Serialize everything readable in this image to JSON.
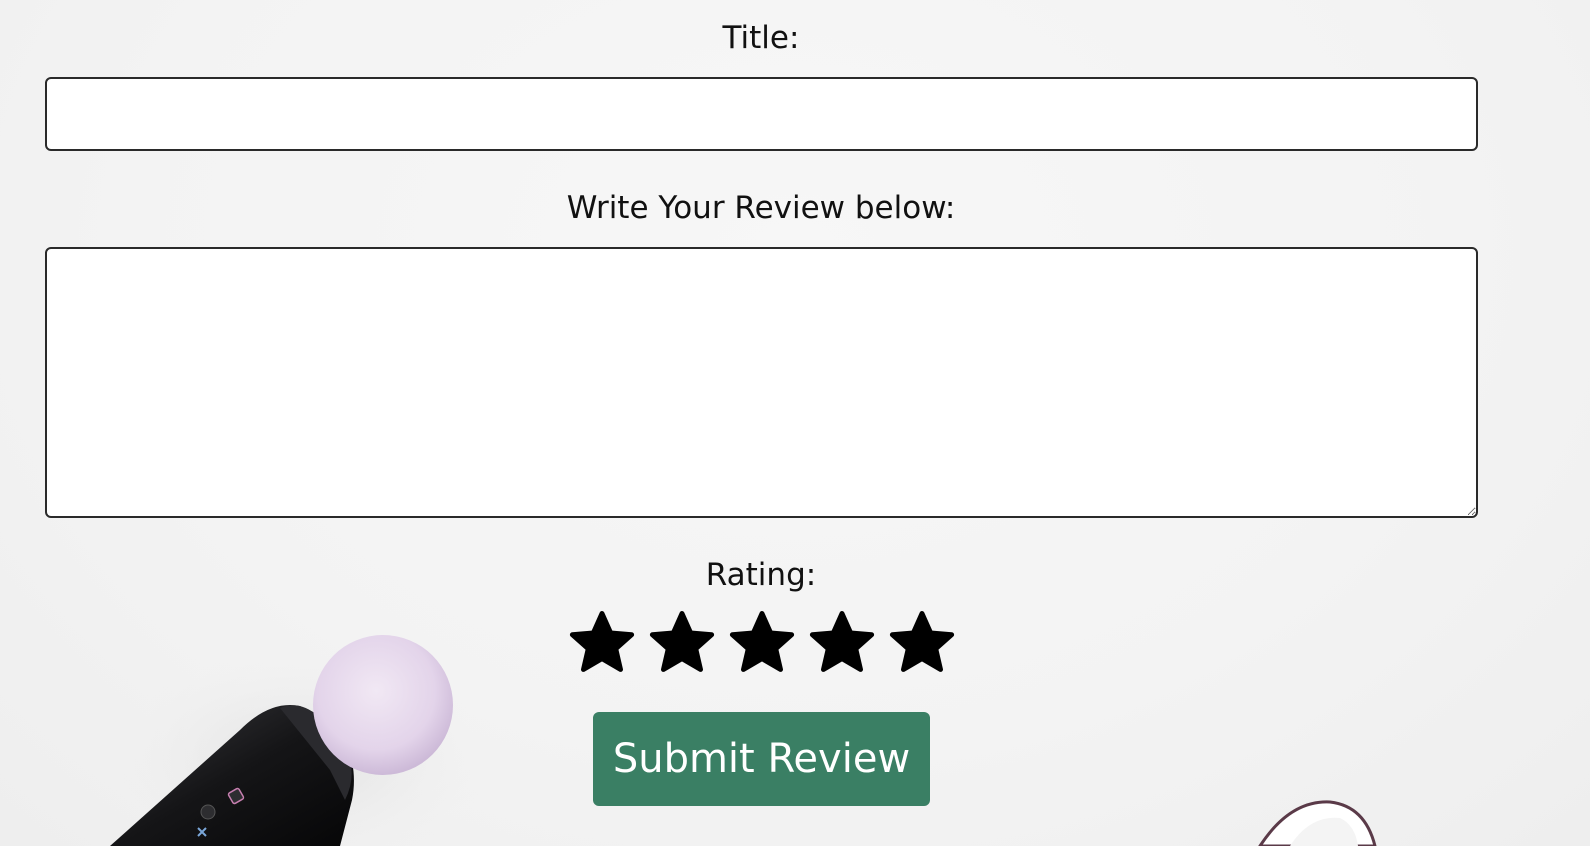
{
  "form": {
    "title_label": "Title:",
    "title_value": "",
    "title_placeholder": "",
    "review_label": "Write Your Review below:",
    "review_value": "",
    "review_placeholder": "",
    "rating_label": "Rating:",
    "rating_max": 5,
    "star_icon": "star-icon",
    "star_color": "#000000",
    "submit_label": "Submit Review",
    "submit_color": "#3a7f64"
  },
  "background": {
    "description_icons": [
      "motion-controller-photo",
      "white-object-photo"
    ]
  }
}
